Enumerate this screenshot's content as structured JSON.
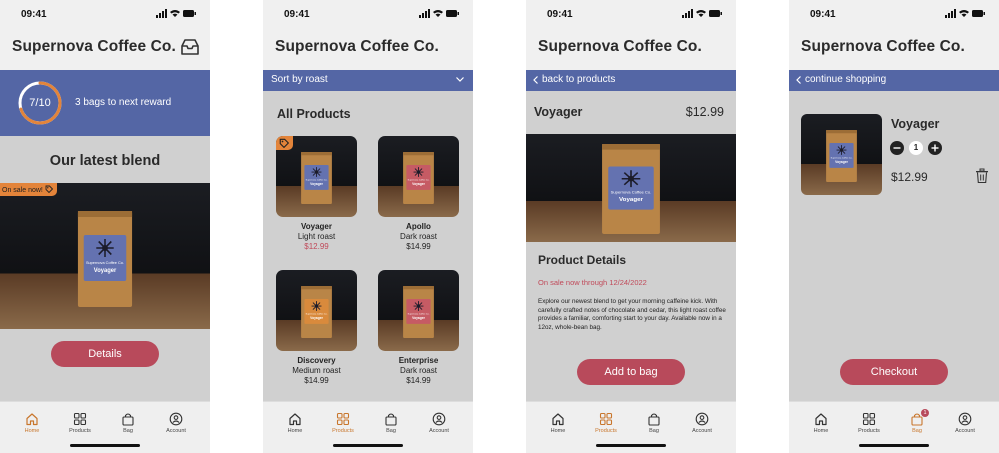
{
  "status": {
    "time": "09:41"
  },
  "app_title": "Supernova Coffee Co.",
  "colors": {
    "accent_blue": "#5466a5",
    "brand_red": "#b84a5b",
    "orange": "#e3843a",
    "sale_red": "#c04a5a"
  },
  "nav": {
    "home": "Home",
    "products": "Products",
    "bag": "Bag",
    "account": "Account"
  },
  "screen_home": {
    "progress": {
      "label": "7/10",
      "value": 0.7
    },
    "reward_text": "3 bags to next reward",
    "section_title": "Our latest blend",
    "sale_badge": "On sale now!",
    "details_button": "Details"
  },
  "screen_products": {
    "sort_label": "Sort by roast",
    "section_title": "All Products",
    "products": [
      {
        "name": "Voyager",
        "roast": "Light roast",
        "price": "$12.99",
        "on_sale": true
      },
      {
        "name": "Apollo",
        "roast": "Dark roast",
        "price": "$14.99",
        "on_sale": false
      },
      {
        "name": "Discovery",
        "roast": "Medium roast",
        "price": "$14.99",
        "on_sale": false
      },
      {
        "name": "Enterprise",
        "roast": "Dark roast",
        "price": "$14.99",
        "on_sale": false
      }
    ]
  },
  "screen_detail": {
    "back_label": "back to products",
    "product_name": "Voyager",
    "price": "$12.99",
    "details_title": "Product Details",
    "sale_note": "On sale now through 12/24/2022",
    "description": "Explore our newest blend to get your morning caffeine kick. With carefully crafted notes of chocolate and cedar, this light roast coffee provides a familiar, comforting start to your day. Available now in a 12oz, whole-bean bag.",
    "add_button": "Add to bag"
  },
  "screen_bag": {
    "back_label": "continue shopping",
    "item_name": "Voyager",
    "quantity": "1",
    "price": "$12.99",
    "checkout_button": "Checkout",
    "bag_badge_count": "1"
  },
  "bag_label": {
    "brand": "Supernova Coffee Co.",
    "name": "Voyager"
  }
}
